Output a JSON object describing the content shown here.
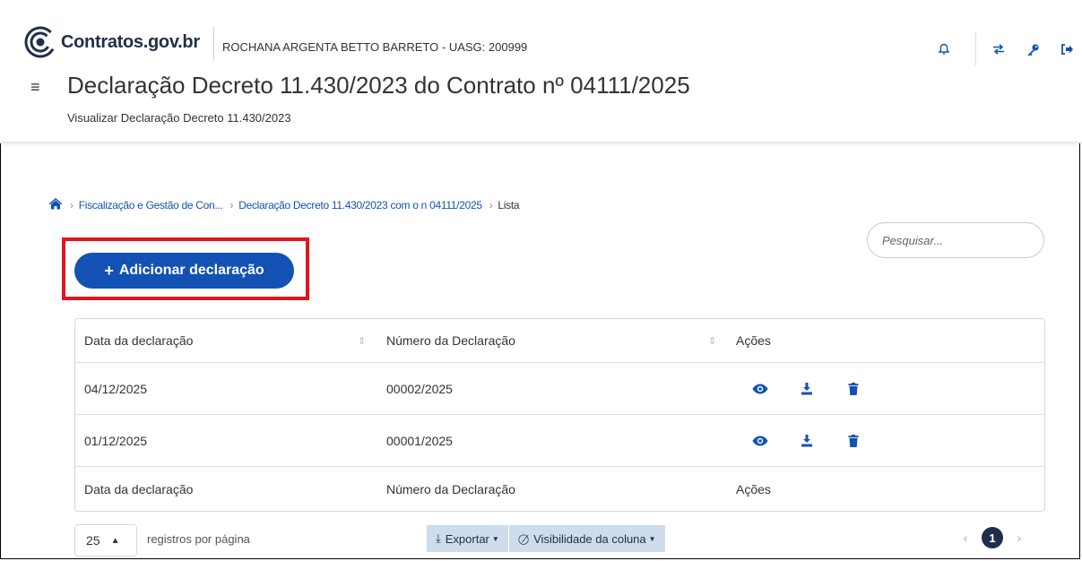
{
  "app": {
    "logo_text": "Contratos.gov.br",
    "user_info": "ROCHANA ARGENTA BETTO BARRETO - UASG: 200999"
  },
  "header": {
    "title": "Declaração Decreto 11.430/2023 do Contrato nº 04111/2025",
    "subtitle": "Visualizar Declaração Decreto 11.430/2023",
    "icons": [
      "bell-icon",
      "swap-icon",
      "key-icon",
      "logout-icon"
    ]
  },
  "breadcrumb": {
    "items": [
      "Fiscalização e Gestão de Con...",
      "Declaração Decreto 11.430/2023 com o n 04111/2025",
      "Lista"
    ]
  },
  "toolbar": {
    "add_label": "Adicionar declaração",
    "search_placeholder": "Pesquisar..."
  },
  "table": {
    "headers": [
      "Data da declaração",
      "Número da Declaração",
      "Ações"
    ],
    "rows": [
      {
        "date": "04/12/2025",
        "number": "00002/2025"
      },
      {
        "date": "01/12/2025",
        "number": "00001/2025"
      }
    ],
    "action_icons": [
      "view-icon",
      "download-icon",
      "delete-icon"
    ]
  },
  "footer": {
    "per_page_value": "25",
    "per_page_label": "registros por página",
    "export_label": "Exportar",
    "visibility_label": "Visibilidade da coluna",
    "current_page": "1"
  },
  "colors": {
    "primary": "#1351b4",
    "dark": "#1f2e4a",
    "highlight": "#e2141e"
  }
}
